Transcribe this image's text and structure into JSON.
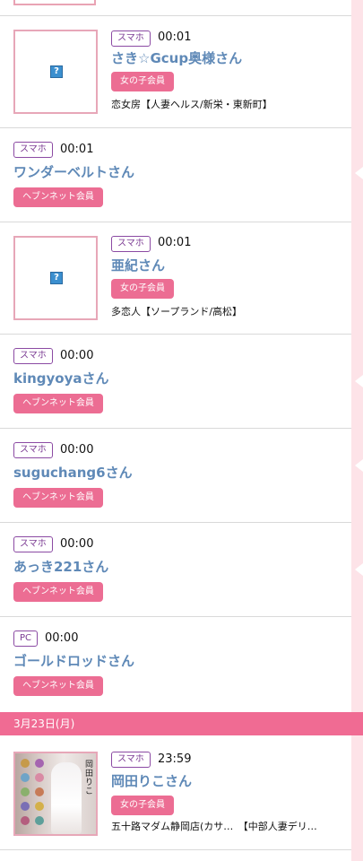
{
  "entries": [
    {
      "device": "スマホ",
      "time": "00:01",
      "name": "さき☆Gcup奥様さん",
      "badge": "女の子会員",
      "shop": "恋女房【人妻ヘルス/新栄・東新町】"
    },
    {
      "device": "スマホ",
      "time": "00:01",
      "name": "ワンダーベルトさん",
      "badge": "ヘブンネット会員"
    },
    {
      "device": "スマホ",
      "time": "00:01",
      "name": "亜紀さん",
      "badge": "女の子会員",
      "shop": "多恋人【ソープランド/高松】"
    },
    {
      "device": "スマホ",
      "time": "00:00",
      "name": "kingyoyaさん",
      "badge": "ヘブンネット会員"
    },
    {
      "device": "スマホ",
      "time": "00:00",
      "name": "suguchang6さん",
      "badge": "ヘブンネット会員"
    },
    {
      "device": "スマホ",
      "time": "00:00",
      "name": "あっき221さん",
      "badge": "ヘブンネット会員"
    },
    {
      "device": "PC",
      "time": "00:00",
      "name": "ゴールドロッドさん",
      "badge": "ヘブンネット会員"
    },
    {
      "device": "スマホ",
      "time": "23:59",
      "name": "岡田りこさん",
      "badge": "女の子会員",
      "shop": "五十路マダム静岡店(カサ…　【中部人妻デリ…"
    }
  ],
  "date_header": "3月23日(月)",
  "photo_text": "岡田りこ"
}
